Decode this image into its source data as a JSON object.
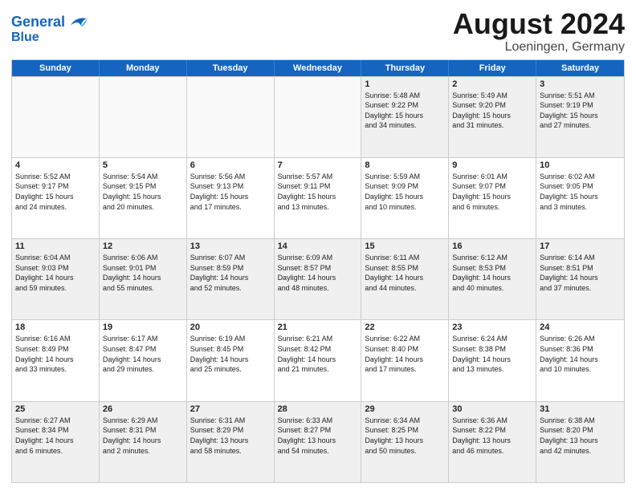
{
  "logo": {
    "line1": "General",
    "line2": "Blue"
  },
  "title": {
    "month_year": "August 2024",
    "location": "Loeningen, Germany"
  },
  "header_days": [
    "Sunday",
    "Monday",
    "Tuesday",
    "Wednesday",
    "Thursday",
    "Friday",
    "Saturday"
  ],
  "weeks": [
    [
      {
        "day": "",
        "text": "",
        "empty": true
      },
      {
        "day": "",
        "text": "",
        "empty": true
      },
      {
        "day": "",
        "text": "",
        "empty": true
      },
      {
        "day": "",
        "text": "",
        "empty": true
      },
      {
        "day": "1",
        "text": "Sunrise: 5:48 AM\nSunset: 9:22 PM\nDaylight: 15 hours\nand 34 minutes.",
        "empty": false
      },
      {
        "day": "2",
        "text": "Sunrise: 5:49 AM\nSunset: 9:20 PM\nDaylight: 15 hours\nand 31 minutes.",
        "empty": false
      },
      {
        "day": "3",
        "text": "Sunrise: 5:51 AM\nSunset: 9:19 PM\nDaylight: 15 hours\nand 27 minutes.",
        "empty": false
      }
    ],
    [
      {
        "day": "4",
        "text": "Sunrise: 5:52 AM\nSunset: 9:17 PM\nDaylight: 15 hours\nand 24 minutes.",
        "empty": false
      },
      {
        "day": "5",
        "text": "Sunrise: 5:54 AM\nSunset: 9:15 PM\nDaylight: 15 hours\nand 20 minutes.",
        "empty": false
      },
      {
        "day": "6",
        "text": "Sunrise: 5:56 AM\nSunset: 9:13 PM\nDaylight: 15 hours\nand 17 minutes.",
        "empty": false
      },
      {
        "day": "7",
        "text": "Sunrise: 5:57 AM\nSunset: 9:11 PM\nDaylight: 15 hours\nand 13 minutes.",
        "empty": false
      },
      {
        "day": "8",
        "text": "Sunrise: 5:59 AM\nSunset: 9:09 PM\nDaylight: 15 hours\nand 10 minutes.",
        "empty": false
      },
      {
        "day": "9",
        "text": "Sunrise: 6:01 AM\nSunset: 9:07 PM\nDaylight: 15 hours\nand 6 minutes.",
        "empty": false
      },
      {
        "day": "10",
        "text": "Sunrise: 6:02 AM\nSunset: 9:05 PM\nDaylight: 15 hours\nand 3 minutes.",
        "empty": false
      }
    ],
    [
      {
        "day": "11",
        "text": "Sunrise: 6:04 AM\nSunset: 9:03 PM\nDaylight: 14 hours\nand 59 minutes.",
        "empty": false
      },
      {
        "day": "12",
        "text": "Sunrise: 6:06 AM\nSunset: 9:01 PM\nDaylight: 14 hours\nand 55 minutes.",
        "empty": false
      },
      {
        "day": "13",
        "text": "Sunrise: 6:07 AM\nSunset: 8:59 PM\nDaylight: 14 hours\nand 52 minutes.",
        "empty": false
      },
      {
        "day": "14",
        "text": "Sunrise: 6:09 AM\nSunset: 8:57 PM\nDaylight: 14 hours\nand 48 minutes.",
        "empty": false
      },
      {
        "day": "15",
        "text": "Sunrise: 6:11 AM\nSunset: 8:55 PM\nDaylight: 14 hours\nand 44 minutes.",
        "empty": false
      },
      {
        "day": "16",
        "text": "Sunrise: 6:12 AM\nSunset: 8:53 PM\nDaylight: 14 hours\nand 40 minutes.",
        "empty": false
      },
      {
        "day": "17",
        "text": "Sunrise: 6:14 AM\nSunset: 8:51 PM\nDaylight: 14 hours\nand 37 minutes.",
        "empty": false
      }
    ],
    [
      {
        "day": "18",
        "text": "Sunrise: 6:16 AM\nSunset: 8:49 PM\nDaylight: 14 hours\nand 33 minutes.",
        "empty": false
      },
      {
        "day": "19",
        "text": "Sunrise: 6:17 AM\nSunset: 8:47 PM\nDaylight: 14 hours\nand 29 minutes.",
        "empty": false
      },
      {
        "day": "20",
        "text": "Sunrise: 6:19 AM\nSunset: 8:45 PM\nDaylight: 14 hours\nand 25 minutes.",
        "empty": false
      },
      {
        "day": "21",
        "text": "Sunrise: 6:21 AM\nSunset: 8:42 PM\nDaylight: 14 hours\nand 21 minutes.",
        "empty": false
      },
      {
        "day": "22",
        "text": "Sunrise: 6:22 AM\nSunset: 8:40 PM\nDaylight: 14 hours\nand 17 minutes.",
        "empty": false
      },
      {
        "day": "23",
        "text": "Sunrise: 6:24 AM\nSunset: 8:38 PM\nDaylight: 14 hours\nand 13 minutes.",
        "empty": false
      },
      {
        "day": "24",
        "text": "Sunrise: 6:26 AM\nSunset: 8:36 PM\nDaylight: 14 hours\nand 10 minutes.",
        "empty": false
      }
    ],
    [
      {
        "day": "25",
        "text": "Sunrise: 6:27 AM\nSunset: 8:34 PM\nDaylight: 14 hours\nand 6 minutes.",
        "empty": false
      },
      {
        "day": "26",
        "text": "Sunrise: 6:29 AM\nSunset: 8:31 PM\nDaylight: 14 hours\nand 2 minutes.",
        "empty": false
      },
      {
        "day": "27",
        "text": "Sunrise: 6:31 AM\nSunset: 8:29 PM\nDaylight: 13 hours\nand 58 minutes.",
        "empty": false
      },
      {
        "day": "28",
        "text": "Sunrise: 6:33 AM\nSunset: 8:27 PM\nDaylight: 13 hours\nand 54 minutes.",
        "empty": false
      },
      {
        "day": "29",
        "text": "Sunrise: 6:34 AM\nSunset: 8:25 PM\nDaylight: 13 hours\nand 50 minutes.",
        "empty": false
      },
      {
        "day": "30",
        "text": "Sunrise: 6:36 AM\nSunset: 8:22 PM\nDaylight: 13 hours\nand 46 minutes.",
        "empty": false
      },
      {
        "day": "31",
        "text": "Sunrise: 6:38 AM\nSunset: 8:20 PM\nDaylight: 13 hours\nand 42 minutes.",
        "empty": false
      }
    ]
  ]
}
